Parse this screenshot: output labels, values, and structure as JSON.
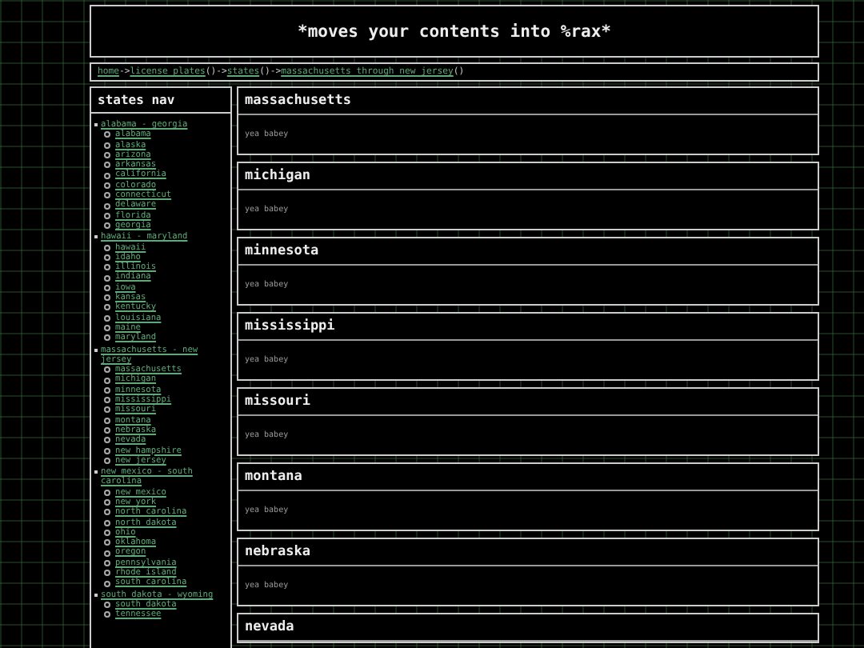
{
  "header": {
    "title": "*moves your contents into %rax*"
  },
  "breadcrumb": [
    {
      "label": "home",
      "after": "->"
    },
    {
      "label": "license_plates",
      "after": "()->"
    },
    {
      "label": "states",
      "after": "()->"
    },
    {
      "label": "massachusetts_through_new_jersey",
      "after": "()"
    }
  ],
  "sidebar": {
    "title": "states nav",
    "groups": [
      {
        "label": "alabama - georgia",
        "children": [
          {
            "label": "alabama"
          },
          {
            "label": "alaska"
          },
          {
            "label": "arizona"
          },
          {
            "label": "arkansas"
          },
          {
            "label": "california"
          },
          {
            "label": "colorado"
          },
          {
            "label": "connecticut"
          },
          {
            "label": "delaware"
          },
          {
            "label": "florida"
          },
          {
            "label": "georgia"
          }
        ]
      },
      {
        "label": "hawaii - maryland",
        "children": [
          {
            "label": "hawaii"
          },
          {
            "label": "idaho"
          },
          {
            "label": "illinois"
          },
          {
            "label": "indiana"
          },
          {
            "label": "iowa"
          },
          {
            "label": "kansas"
          },
          {
            "label": "kentucky"
          },
          {
            "label": "louisiana"
          },
          {
            "label": "maine"
          },
          {
            "label": "maryland"
          }
        ]
      },
      {
        "label": "massachusetts - new jersey",
        "children": [
          {
            "label": "massachusetts"
          },
          {
            "label": "michigan"
          },
          {
            "label": "minnesota"
          },
          {
            "label": "mississippi"
          },
          {
            "label": "missouri"
          },
          {
            "label": "montana"
          },
          {
            "label": "nebraska"
          },
          {
            "label": "nevada"
          },
          {
            "label": "new hampshire"
          },
          {
            "label": "new jersey"
          }
        ]
      },
      {
        "label": "new mexico - south carolina",
        "children": [
          {
            "label": "new mexico"
          },
          {
            "label": "new york"
          },
          {
            "label": "north carolina"
          },
          {
            "label": "north dakota"
          },
          {
            "label": "ohio"
          },
          {
            "label": "oklahoma"
          },
          {
            "label": "oregon"
          },
          {
            "label": "pennsylvania"
          },
          {
            "label": "rhode island"
          },
          {
            "label": "south carolina"
          }
        ]
      },
      {
        "label": "south dakota - wyoming",
        "children": [
          {
            "label": "south dakota"
          },
          {
            "label": "tennessee"
          }
        ]
      }
    ]
  },
  "cards": [
    {
      "title": "massachusetts",
      "body": "yea babey"
    },
    {
      "title": "michigan",
      "body": "yea babey"
    },
    {
      "title": "minnesota",
      "body": "yea babey"
    },
    {
      "title": "mississippi",
      "body": "yea babey"
    },
    {
      "title": "missouri",
      "body": "yea babey"
    },
    {
      "title": "montana",
      "body": "yea babey"
    },
    {
      "title": "nebraska",
      "body": "yea babey"
    },
    {
      "title": "nevada"
    }
  ]
}
